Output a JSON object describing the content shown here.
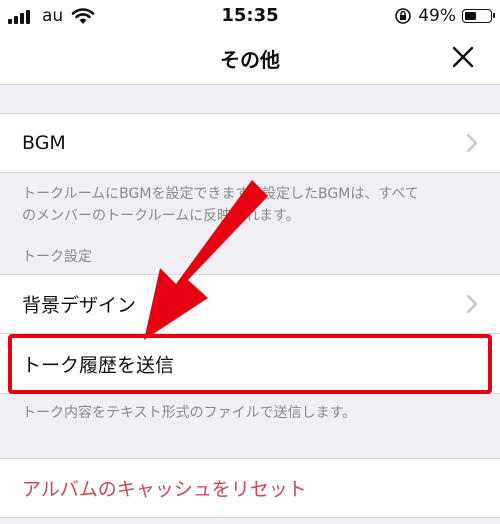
{
  "status_bar": {
    "carrier": "au",
    "time": "15:35",
    "battery_percent_text": "49%",
    "battery_level": 0.49
  },
  "nav": {
    "title": "その他",
    "close_icon": "close-icon"
  },
  "rows": {
    "bgm": {
      "label": "BGM"
    },
    "background": {
      "label": "背景デザイン"
    },
    "send_history": {
      "label": "トーク履歴を送信"
    },
    "reset_cache": {
      "label": "アルバムのキャッシュをリセット"
    }
  },
  "descriptions": {
    "bgm_line1": "トークルームにBGMを設定できます。設定したBGMは、すべて",
    "bgm_line2": "のメンバーのトークルームに反映されます。",
    "send_history": "トーク内容をテキスト形式のファイルで送信します。"
  },
  "section_headers": {
    "talk_settings": "トーク設定"
  },
  "colors": {
    "highlight": "#e60012",
    "reset_text": "#c9485b",
    "background": "#efeff4"
  }
}
